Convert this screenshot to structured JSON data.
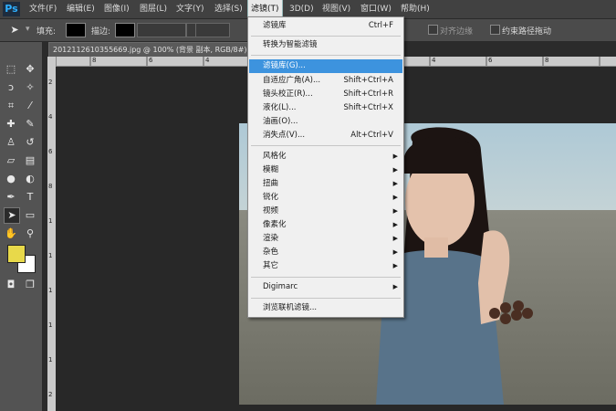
{
  "app": {
    "logo": "Ps"
  },
  "menubar": {
    "items": [
      "文件(F)",
      "编辑(E)",
      "图像(I)",
      "图层(L)",
      "文字(Y)",
      "选择(S)",
      "滤镜(T)",
      "3D(D)",
      "视图(V)",
      "窗口(W)",
      "帮助(H)"
    ],
    "active_index": 6
  },
  "options": {
    "fill_label": "填充:",
    "stroke_label": "描边:",
    "align_edges_label": "对齐边缘",
    "constrain_path_label": "约束路径拖动"
  },
  "document": {
    "tab_title": "2012112610355669.jpg @ 100% (背景 副本, RGB/8#)",
    "ruler_top_numbers": [
      "8",
      "6",
      "4",
      "2",
      "0",
      "2",
      "4",
      "6",
      "8"
    ],
    "ruler_left_numbers": [
      "2",
      "4",
      "6",
      "8",
      "1",
      "1",
      "1",
      "1",
      "1",
      "2"
    ]
  },
  "filter_menu": {
    "items": [
      {
        "label": "滤镜库",
        "shortcut": "Ctrl+F"
      },
      {
        "separator": true
      },
      {
        "label": "转换为智能滤镜"
      },
      {
        "separator": true
      },
      {
        "label": "滤镜库(G)...",
        "highlighted": true
      },
      {
        "label": "自适应广角(A)...",
        "shortcut": "Shift+Ctrl+A"
      },
      {
        "label": "镜头校正(R)...",
        "shortcut": "Shift+Ctrl+R"
      },
      {
        "label": "液化(L)...",
        "shortcut": "Shift+Ctrl+X"
      },
      {
        "label": "油画(O)..."
      },
      {
        "label": "消失点(V)...",
        "shortcut": "Alt+Ctrl+V"
      },
      {
        "separator": true
      },
      {
        "label": "风格化",
        "submenu": true
      },
      {
        "label": "模糊",
        "submenu": true
      },
      {
        "label": "扭曲",
        "submenu": true
      },
      {
        "label": "锐化",
        "submenu": true
      },
      {
        "label": "视频",
        "submenu": true
      },
      {
        "label": "像素化",
        "submenu": true
      },
      {
        "label": "渲染",
        "submenu": true
      },
      {
        "label": "杂色",
        "submenu": true
      },
      {
        "label": "其它",
        "submenu": true
      },
      {
        "separator": true
      },
      {
        "label": "Digimarc",
        "submenu": true
      },
      {
        "separator": true
      },
      {
        "label": "浏览联机滤镜..."
      }
    ]
  },
  "colors": {
    "foreground": "#e8d94a",
    "background": "#ffffff",
    "menu_highlight": "#3d93de"
  },
  "tool_icons": [
    "marquee-icon",
    "move-icon",
    "lasso-icon",
    "magic-wand-icon",
    "crop-icon",
    "eyedropper-icon",
    "healing-brush-icon",
    "brush-icon",
    "clone-stamp-icon",
    "history-brush-icon",
    "eraser-icon",
    "gradient-icon",
    "blur-icon",
    "dodge-icon",
    "pen-icon",
    "type-icon",
    "path-selection-icon",
    "shape-icon",
    "hand-icon",
    "zoom-icon"
  ]
}
